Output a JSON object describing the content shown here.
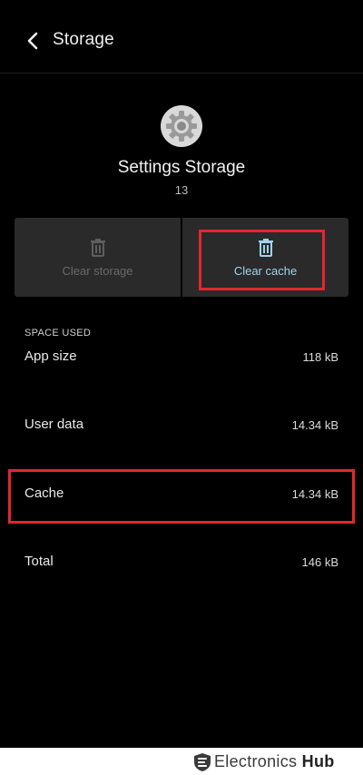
{
  "header": {
    "title": "Storage",
    "back_icon": "chevron-left-icon"
  },
  "app": {
    "name": "Settings Storage",
    "version": "13",
    "icon": "gear-icon"
  },
  "actions": {
    "clear_storage": {
      "label": "Clear storage",
      "icon": "trash-icon",
      "enabled": false
    },
    "clear_cache": {
      "label": "Clear cache",
      "icon": "trash-icon",
      "enabled": true
    }
  },
  "space_used": {
    "section_title": "SPACE USED",
    "app_size": {
      "label": "App size",
      "value": "118 kB"
    },
    "user_data": {
      "label": "User data",
      "value": "14.34 kB"
    },
    "cache": {
      "label": "Cache",
      "value": "14.34 kB"
    },
    "total": {
      "label": "Total",
      "value": "146 kB"
    }
  },
  "watermark": {
    "brand_regular": "Electronics",
    "brand_bold": "Hub"
  },
  "colors": {
    "background": "#000000",
    "button_bg": "#2a2a2a",
    "accent": "#9fd3ee",
    "highlight": "#e32630"
  }
}
